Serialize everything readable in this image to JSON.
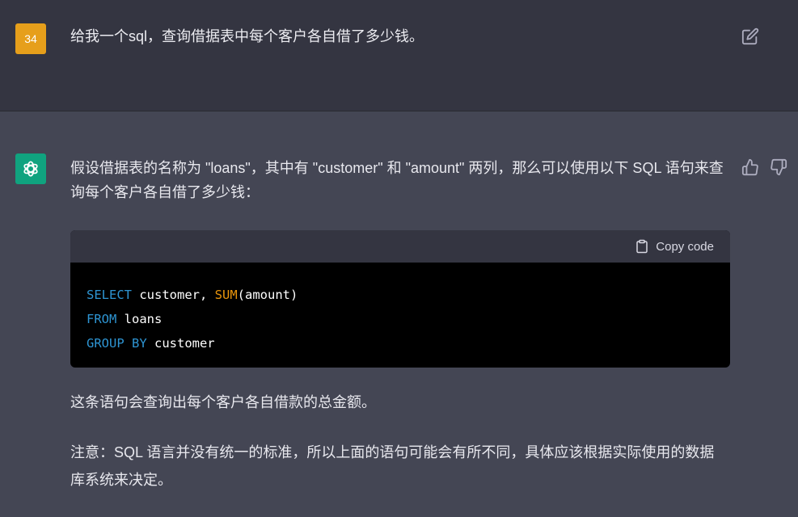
{
  "user_message": {
    "avatar_text": "34",
    "text": "给我一个sql，查询借据表中每个客户各自借了多少钱。"
  },
  "assistant_message": {
    "intro": "假设借据表的名称为 \"loans\"，其中有 \"customer\" 和 \"amount\" 两列，那么可以使用以下 SQL 语句来查询每个客户各自借了多少钱：",
    "code": {
      "copy_label": "Copy code",
      "line1": {
        "kw1": "SELECT",
        "t1": " customer, ",
        "fn": "SUM",
        "t2": "(amount)"
      },
      "line2": {
        "kw": "FROM",
        "t": " loans"
      },
      "line3": {
        "kw": "GROUP BY",
        "t": " customer"
      }
    },
    "para1": "这条语句会查询出每个客户各自借款的总金额。",
    "para2": "注意：SQL 语言并没有统一的标准，所以上面的语句可能会有所不同，具体应该根据实际使用的数据库系统来决定。"
  },
  "colors": {
    "user_avatar": "#e69f1b",
    "assistant_avatar": "#10a37f",
    "keyword": "#2e95d3",
    "function": "#e9950c"
  },
  "icons": [
    "edit-icon",
    "openai-logo-icon",
    "thumbs-up-icon",
    "thumbs-down-icon",
    "clipboard-icon"
  ]
}
